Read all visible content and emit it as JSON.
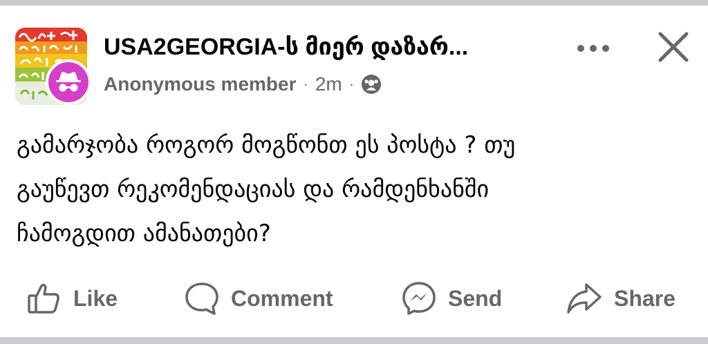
{
  "post": {
    "group_name": "USA2GEORGIA-ს მიერ დაზარ...",
    "author": "Anonymous member",
    "time": "2m",
    "separator": "·",
    "body_lines": [
      "გამარჯობა როგორ მოგწონთ ეს პოსტა ? თუ",
      "გაუწევთ რეკომენდაციას და  რამდენხანში",
      "ჩამოგდით ამანათები?"
    ]
  },
  "header": {
    "more_icon": "more-dots-icon",
    "close_icon": "close-icon",
    "privacy_icon": "group-members-icon",
    "anonymous_icon": "anonymous-incognito-icon"
  },
  "actions": {
    "like_label": "Like",
    "comment_label": "Comment",
    "send_label": "Send",
    "share_label": "Share"
  },
  "colors": {
    "text_primary": "#050505",
    "text_secondary": "#65676b",
    "anonymous_badge": "#d63fc9",
    "divider": "#c9ccd1"
  }
}
